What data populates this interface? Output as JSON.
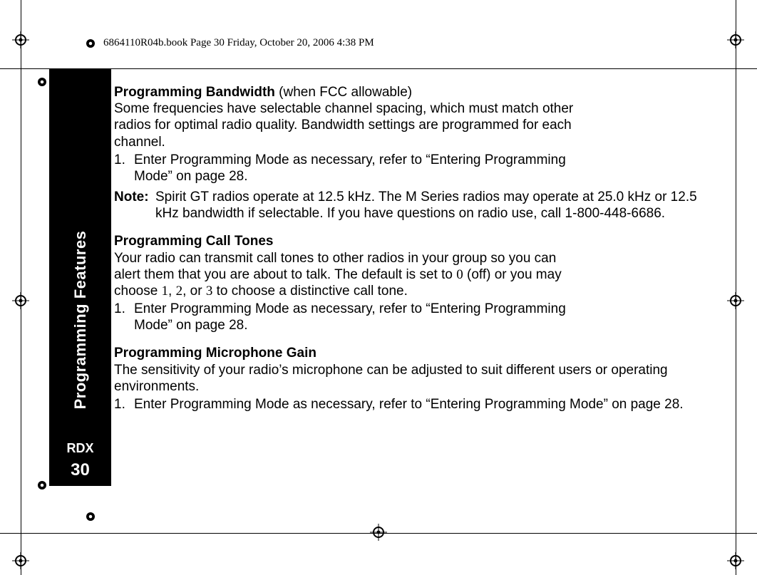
{
  "header": {
    "running_head": "6864110R04b.book  Page 30  Friday, October 20, 2006  4:38 PM"
  },
  "tab": {
    "section_title": "Programming Features",
    "model": "RDX",
    "page_number": "30"
  },
  "content": {
    "bandwidth": {
      "heading": "Programming Bandwidth",
      "heading_suffix": " (when FCC allowable)",
      "para": "Some frequencies have selectable channel spacing, which must match other radios for optimal radio quality. Bandwidth settings are programmed for each channel.",
      "step_num": "1.",
      "step": "Enter Programming Mode as necessary, refer to “Entering Programming Mode” on page 28.",
      "note_label": "Note:",
      "note": "Spirit GT radios operate at 12.5 kHz. The M Series radios may operate at 25.0 kHz or 12.5 kHz bandwidth if selectable. If you have questions on radio use, call 1-800-448-6686."
    },
    "calltones": {
      "heading": "Programming Call Tones",
      "para_a": "Your radio can transmit call tones to other radios in your group so you can alert them that you are about to talk. The default is set to ",
      "d0": "0",
      "para_b": " (off) or you may choose ",
      "d1": "1",
      "comma1": ", ",
      "d2": "2",
      "comma2": ", or ",
      "d3": "3",
      "para_c": " to choose a distinctive call tone.",
      "step_num": "1.",
      "step": "Enter Programming Mode as necessary, refer to “Entering Programming Mode” on page 28."
    },
    "micgain": {
      "heading": "Programming Microphone Gain",
      "para": "The sensitivity of your radio’s microphone can be adjusted to suit different users or operating environments.",
      "step_num": "1.",
      "step": "Enter Programming Mode as necessary, refer to “Entering Programming Mode” on page 28."
    }
  }
}
